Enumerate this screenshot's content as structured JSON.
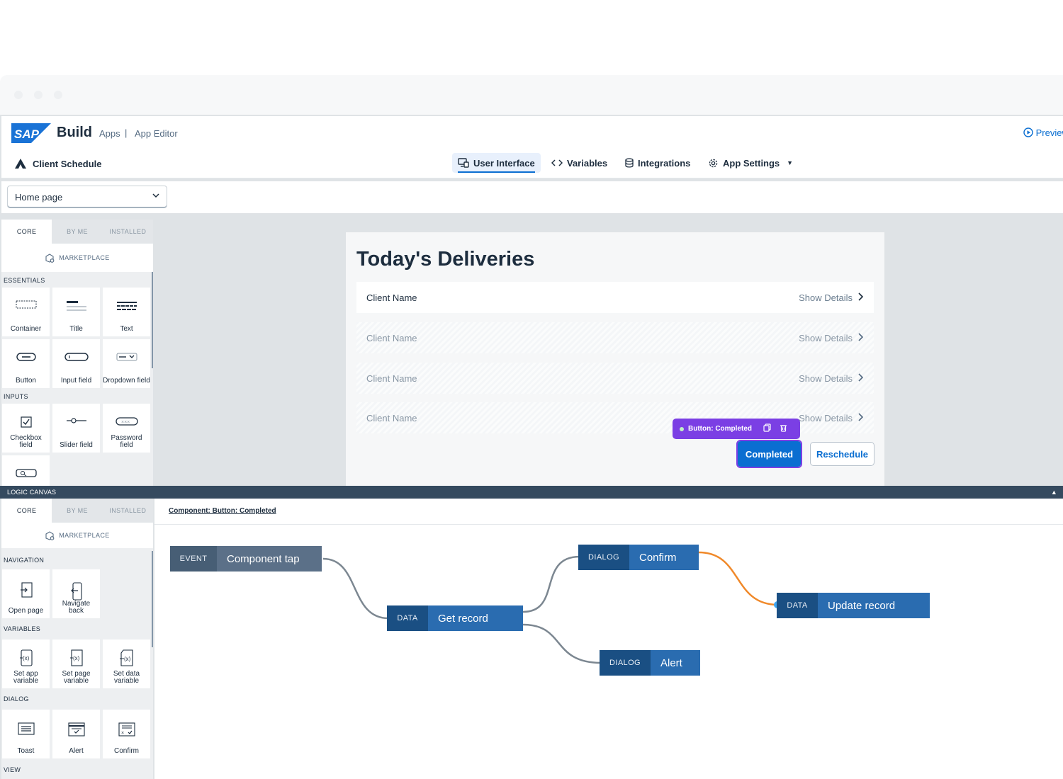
{
  "header": {
    "brand_logo": "SAP",
    "brand_product": "Build",
    "brand_apps": "Apps",
    "brand_separator": "|",
    "brand_editor": "App Editor",
    "preview_label": "Preview",
    "project_name": "Client Schedule",
    "tabs": [
      {
        "label": "User Interface",
        "icon": "ui-monitor-icon",
        "active": true
      },
      {
        "label": "Variables",
        "icon": "code-brackets-icon",
        "active": false
      },
      {
        "label": "Integrations",
        "icon": "database-icon",
        "active": false
      },
      {
        "label": "App Settings",
        "icon": "gear-icon",
        "active": false
      }
    ]
  },
  "page_selector": {
    "value": "Home page"
  },
  "palette_top": {
    "tabs": [
      "CORE",
      "BY ME",
      "INSTALLED"
    ],
    "active_tab": "CORE",
    "marketplace_label": "MARKETPLACE",
    "sections": [
      {
        "title": "ESSENTIALS",
        "items": [
          "Container",
          "Title",
          "Text",
          "Button",
          "Input field",
          "Dropdown field"
        ]
      },
      {
        "title": "INPUTS",
        "items": [
          "Checkbox field",
          "Slider field",
          "Password field"
        ]
      }
    ]
  },
  "screen": {
    "title": "Today's Deliveries",
    "rows": [
      {
        "client": "Client Name",
        "action": "Show Details"
      },
      {
        "client": "Client Name",
        "action": "Show Details"
      },
      {
        "client": "Client Name",
        "action": "Show Details"
      },
      {
        "client": "Client Name",
        "action": "Show Details"
      }
    ],
    "selection_label": "Button: Completed",
    "completed_label": "Completed",
    "reschedule_label": "Reschedule"
  },
  "logic": {
    "bar_label": "LOGIC CANVAS",
    "component_link": "Component: Button: Completed",
    "nodes": {
      "event": {
        "tag": "EVENT",
        "label": "Component tap"
      },
      "get_record": {
        "tag": "DATA",
        "label": "Get record"
      },
      "confirm": {
        "tag": "DIALOG",
        "label": "Confirm"
      },
      "alert": {
        "tag": "DIALOG",
        "label": "Alert"
      },
      "update_record": {
        "tag": "DATA",
        "label": "Update record"
      }
    }
  },
  "palette_bottom": {
    "tabs": [
      "CORE",
      "BY ME",
      "INSTALLED"
    ],
    "active_tab": "CORE",
    "marketplace_label": "MARKETPLACE",
    "sections": [
      {
        "title": "NAVIGATION",
        "items": [
          "Open page",
          "Navigate back"
        ]
      },
      {
        "title": "VARIABLES",
        "items": [
          "Set app variable",
          "Set page variable",
          "Set data variable"
        ]
      },
      {
        "title": "DIALOG",
        "items": [
          "Toast",
          "Alert",
          "Confirm"
        ]
      },
      {
        "title": "VIEW",
        "items": []
      }
    ]
  },
  "colors": {
    "accent": "#0a6ed1",
    "selection": "#7b3fe4",
    "connector_active": "#f0892a"
  }
}
